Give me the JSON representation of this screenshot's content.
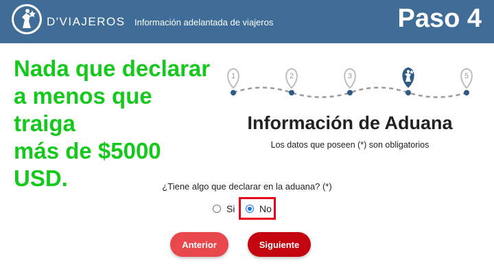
{
  "header": {
    "brand": "D'VIAJEROS",
    "subtitle": "Información adelantada de viajeros",
    "step_label": "Paso 4",
    "logo_icon": "traveler-star-logo-icon"
  },
  "note": {
    "lines": [
      "Nada que declarar",
      "a menos que traiga",
      "más de $5000 USD."
    ]
  },
  "stepper": {
    "steps": [
      "1",
      "2",
      "3",
      "",
      "5"
    ],
    "current_step": 4,
    "current_icon": "traveler-pin-icon"
  },
  "form": {
    "title": "Información de Aduana",
    "required_note": "Los datos que poseen (*) son obligatorios",
    "question": "¿Tiene algo que declarar en la aduana? (*)",
    "options": [
      {
        "label": "Si",
        "checked": false
      },
      {
        "label": "No",
        "checked": true
      }
    ]
  },
  "buttons": {
    "prev": "Anterior",
    "next": "Siguiente"
  },
  "colors": {
    "header": "#3f6d97",
    "note": "#14c91c",
    "highlight": "#e3001b",
    "prev": "#e8474c",
    "next": "#c4040f",
    "step_dot": "#2e5a86"
  }
}
